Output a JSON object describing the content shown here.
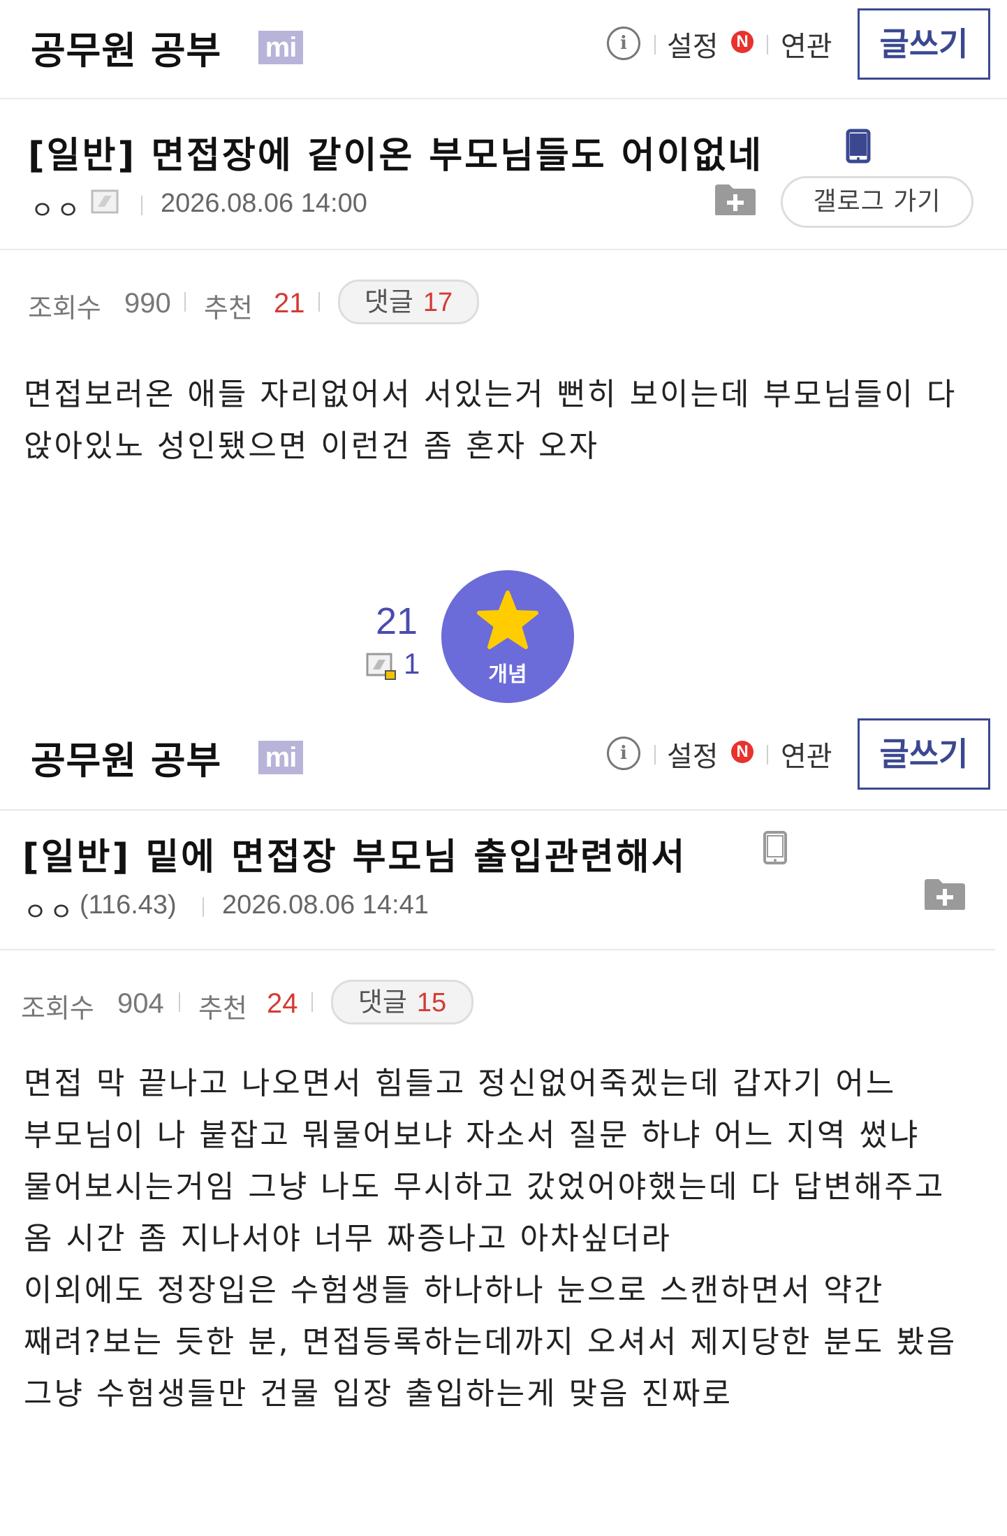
{
  "posts": [
    {
      "gallery": {
        "name": "공무원 공부",
        "badge": "mi",
        "settings_label": "설정",
        "settings_badge": "N",
        "related_label": "연관",
        "write_label": "글쓰기"
      },
      "title": "[일반] 면접장에 같이온 부모님들도 어이없네",
      "author": "ㅇㅇ",
      "datetime": "2026.08.06 14:00",
      "gallog_label": "갤로그 가기",
      "stats": {
        "views_label": "조회수",
        "views": "990",
        "rec_label": "추천",
        "rec": "21",
        "comments_label": "댓글",
        "comments": "17"
      },
      "body": [
        "면접보러온 애들 자리없어서 서있는거 뻔히 보이는데 부모님들이 다 앉아있노 성인됐으면 이런건 좀 혼자 오자"
      ],
      "recommend": {
        "count": "21",
        "fixed_count": "1",
        "button_label": "개념"
      }
    },
    {
      "gallery": {
        "name": "공무원 공부",
        "badge": "mi",
        "settings_label": "설정",
        "settings_badge": "N",
        "related_label": "연관",
        "write_label": "글쓰기"
      },
      "title": "[일반] 밑에 면접장 부모님 출입관련해서",
      "author": "ㅇㅇ",
      "author_ip": "(116.43)",
      "datetime": "2026.08.06 14:41",
      "stats": {
        "views_label": "조회수",
        "views": "904",
        "rec_label": "추천",
        "rec": "24",
        "comments_label": "댓글",
        "comments": "15"
      },
      "body": [
        "면접 막 끝나고 나오면서 힘들고 정신없어죽겠는데 갑자기 어느 부모님이 나 붙잡고 뭐물어보냐 자소서 질문 하냐 어느 지역 썼냐 물어보시는거임 그냥 나도 무시하고 갔었어야했는데 다 답변해주고 옴 시간 좀 지나서야 너무 짜증나고 아차싶더라",
        "이외에도 정장입은 수험생들 하나하나 눈으로 스캔하면서 약간 째려?보는 듯한 분, 면접등록하는데까지 오셔서 제지당한 분도 봤음 그냥 수험생들만 건물 입장 출입하는게 맞음 진짜로"
      ]
    }
  ],
  "icons": {
    "info": "info-icon",
    "mobile": "mobile-phone-icon",
    "folder_add": "folder-add-icon",
    "gallog": "gallog-member-icon",
    "star": "star-icon"
  },
  "colors": {
    "accent": "#3b4890",
    "recommend": "#6b6bd9",
    "count_red": "#d33b32",
    "badge_purple": "#b7b3d9"
  }
}
